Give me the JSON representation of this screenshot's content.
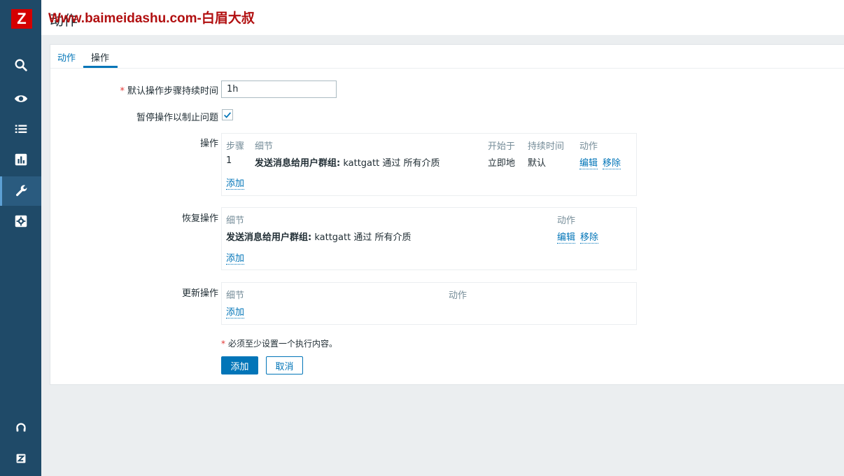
{
  "app": {
    "logo_letter": "Z"
  },
  "header": {
    "title": "动作",
    "watermark": "Www.baimeidashu.com-白眉大叔"
  },
  "tabs": [
    {
      "label": "动作"
    },
    {
      "label": "操作"
    }
  ],
  "form": {
    "default_duration_label": "默认操作步骤持续时间",
    "default_duration_value": "1h",
    "pause_label": "暂停操作以制止问题",
    "pause_checked": true
  },
  "operations": {
    "label": "操作",
    "headers": {
      "steps": "步骤",
      "details": "细节",
      "start_in": "开始于",
      "duration": "持续时间",
      "action": "动作"
    },
    "rows": [
      {
        "step": "1",
        "detail_bold": "发送消息给用户群组:",
        "detail_rest": "kattgatt 通过 所有介质",
        "start_in": "立即地",
        "duration": "默认",
        "edit": "编辑",
        "remove": "移除"
      }
    ],
    "add": "添加"
  },
  "recovery": {
    "label": "恢复操作",
    "headers": {
      "details": "细节",
      "action": "动作"
    },
    "rows": [
      {
        "detail_bold": "发送消息给用户群组:",
        "detail_rest": "kattgatt 通过 所有介质",
        "edit": "编辑",
        "remove": "移除"
      }
    ],
    "add": "添加"
  },
  "update": {
    "label": "更新操作",
    "headers": {
      "details": "细节",
      "action": "动作"
    },
    "add": "添加"
  },
  "note": "必须至少设置一个执行内容。",
  "buttons": {
    "add": "添加",
    "cancel": "取消"
  },
  "colors": {
    "sidebar": "#1f4a68",
    "accent": "#0275b8",
    "logo": "#d40000"
  },
  "sidebar_icons": [
    "search-icon",
    "eye-icon",
    "list-icon",
    "chart-icon",
    "wrench-icon",
    "gear-icon",
    "headset-icon",
    "z-icon"
  ]
}
